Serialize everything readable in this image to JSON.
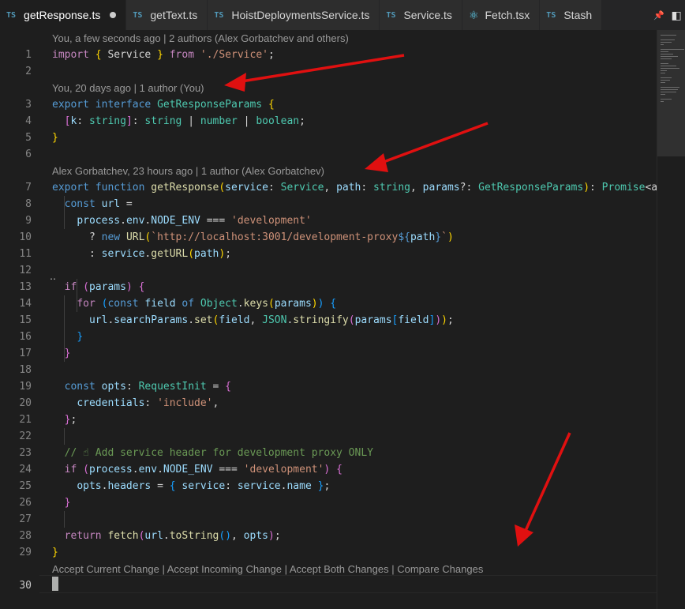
{
  "tabs": [
    {
      "badge": "TS",
      "label": "getResponse.ts",
      "active": true,
      "modified": true
    },
    {
      "badge": "TS",
      "label": "getText.ts"
    },
    {
      "badge": "TS",
      "label": "HoistDeploymentsService.ts"
    },
    {
      "badge": "TS",
      "label": "Service.ts"
    },
    {
      "badge": "⚛",
      "label": "Fetch.tsx"
    },
    {
      "badge": "TS",
      "label": "Stash"
    }
  ],
  "tab_actions": {
    "pin": "📌",
    "split": "◧"
  },
  "lenses": {
    "l1": "You, a few seconds ago | 2 authors (Alex Gorbatchev and others)",
    "l3": "You, 20 days ago | 1 author (You)",
    "l7": "Alex Gorbatchev, 23 hours ago | 1 author (Alex Gorbatchev)",
    "merge": "Accept Current Change | Accept Incoming Change | Accept Both Changes | Compare Changes"
  },
  "line_numbers": [
    "1",
    "2",
    "3",
    "4",
    "5",
    "6",
    "7",
    "8",
    "9",
    "10",
    "11",
    "12",
    "13",
    "14",
    "15",
    "16",
    "17",
    "18",
    "19",
    "20",
    "21",
    "22",
    "23",
    "24",
    "25",
    "26",
    "27",
    "28",
    "29",
    "30"
  ],
  "code": {
    "l1": [
      [
        "k",
        "import"
      ],
      [
        "p",
        " "
      ],
      [
        "br1",
        "{"
      ],
      [
        "p",
        " Service "
      ],
      [
        "br1",
        "}"
      ],
      [
        "p",
        " "
      ],
      [
        "k",
        "from"
      ],
      [
        "p",
        " "
      ],
      [
        "s",
        "'./Service'"
      ],
      [
        "p",
        ";"
      ]
    ],
    "l3": [
      [
        "b",
        "export"
      ],
      [
        "p",
        " "
      ],
      [
        "b",
        "interface"
      ],
      [
        "p",
        " "
      ],
      [
        "t",
        "GetResponseParams"
      ],
      [
        "p",
        " "
      ],
      [
        "br1",
        "{"
      ]
    ],
    "l4": [
      [
        "p",
        "  "
      ],
      [
        "br2",
        "["
      ],
      [
        "v",
        "k"
      ],
      [
        "p",
        ": "
      ],
      [
        "t",
        "string"
      ],
      [
        "br2",
        "]"
      ],
      [
        "p",
        ": "
      ],
      [
        "t",
        "string"
      ],
      [
        "p",
        " | "
      ],
      [
        "t",
        "number"
      ],
      [
        "p",
        " | "
      ],
      [
        "t",
        "boolean"
      ],
      [
        "p",
        ";"
      ]
    ],
    "l5": [
      [
        "br1",
        "}"
      ]
    ],
    "l7": [
      [
        "b",
        "export"
      ],
      [
        "p",
        " "
      ],
      [
        "b",
        "function"
      ],
      [
        "p",
        " "
      ],
      [
        "f",
        "getResponse"
      ],
      [
        "br1",
        "("
      ],
      [
        "v",
        "service"
      ],
      [
        "p",
        ": "
      ],
      [
        "t",
        "Service"
      ],
      [
        "p",
        ", "
      ],
      [
        "v",
        "path"
      ],
      [
        "p",
        ": "
      ],
      [
        "t",
        "string"
      ],
      [
        "p",
        ", "
      ],
      [
        "v",
        "params"
      ],
      [
        "p",
        "?: "
      ],
      [
        "t",
        "GetResponseParams"
      ],
      [
        "br1",
        ")"
      ],
      [
        "p",
        ": "
      ],
      [
        "t",
        "Promise"
      ],
      [
        "p",
        "<any"
      ]
    ],
    "l8": [
      [
        "p",
        "  "
      ],
      [
        "b",
        "const"
      ],
      [
        "p",
        " "
      ],
      [
        "v",
        "url"
      ],
      [
        "p",
        " ="
      ]
    ],
    "l9": [
      [
        "p",
        "    "
      ],
      [
        "v",
        "process"
      ],
      [
        "p",
        "."
      ],
      [
        "v",
        "env"
      ],
      [
        "p",
        "."
      ],
      [
        "v",
        "NODE_ENV"
      ],
      [
        "p",
        " === "
      ],
      [
        "s",
        "'development'"
      ]
    ],
    "l10": [
      [
        "p",
        "      ? "
      ],
      [
        "b",
        "new"
      ],
      [
        "p",
        " "
      ],
      [
        "f",
        "URL"
      ],
      [
        "br1",
        "("
      ],
      [
        "s",
        "`http://localhost:3001/development-proxy"
      ],
      [
        "b",
        "${"
      ],
      [
        "v",
        "path"
      ],
      [
        "b",
        "}"
      ],
      [
        "s",
        "`"
      ],
      [
        "br1",
        ")"
      ]
    ],
    "l11": [
      [
        "p",
        "      : "
      ],
      [
        "v",
        "service"
      ],
      [
        "p",
        "."
      ],
      [
        "f",
        "getURL"
      ],
      [
        "br1",
        "("
      ],
      [
        "v",
        "path"
      ],
      [
        "br1",
        ")"
      ],
      [
        "p",
        ";"
      ]
    ],
    "l13": [
      [
        "p",
        "  "
      ],
      [
        "k",
        "if"
      ],
      [
        "p",
        " "
      ],
      [
        "br2",
        "("
      ],
      [
        "v",
        "params"
      ],
      [
        "br2",
        ")"
      ],
      [
        "p",
        " "
      ],
      [
        "br2",
        "{"
      ]
    ],
    "l14": [
      [
        "p",
        "    "
      ],
      [
        "k",
        "for"
      ],
      [
        "p",
        " "
      ],
      [
        "br3",
        "("
      ],
      [
        "b",
        "const"
      ],
      [
        "p",
        " "
      ],
      [
        "v",
        "field"
      ],
      [
        "p",
        " "
      ],
      [
        "b",
        "of"
      ],
      [
        "p",
        " "
      ],
      [
        "t",
        "Object"
      ],
      [
        "p",
        "."
      ],
      [
        "f",
        "keys"
      ],
      [
        "br1",
        "("
      ],
      [
        "v",
        "params"
      ],
      [
        "br1",
        ")"
      ],
      [
        "br3",
        ")"
      ],
      [
        "p",
        " "
      ],
      [
        "br3",
        "{"
      ]
    ],
    "l15": [
      [
        "p",
        "      "
      ],
      [
        "v",
        "url"
      ],
      [
        "p",
        "."
      ],
      [
        "v",
        "searchParams"
      ],
      [
        "p",
        "."
      ],
      [
        "f",
        "set"
      ],
      [
        "br1",
        "("
      ],
      [
        "v",
        "field"
      ],
      [
        "p",
        ", "
      ],
      [
        "t",
        "JSON"
      ],
      [
        "p",
        "."
      ],
      [
        "f",
        "stringify"
      ],
      [
        "br2",
        "("
      ],
      [
        "v",
        "params"
      ],
      [
        "br3",
        "["
      ],
      [
        "v",
        "field"
      ],
      [
        "br3",
        "]"
      ],
      [
        "br2",
        ")"
      ],
      [
        "br1",
        ")"
      ],
      [
        "p",
        ";"
      ]
    ],
    "l16": [
      [
        "p",
        "    "
      ],
      [
        "br3",
        "}"
      ]
    ],
    "l17": [
      [
        "p",
        "  "
      ],
      [
        "br2",
        "}"
      ]
    ],
    "l19": [
      [
        "p",
        "  "
      ],
      [
        "b",
        "const"
      ],
      [
        "p",
        " "
      ],
      [
        "v",
        "opts"
      ],
      [
        "p",
        ": "
      ],
      [
        "t",
        "RequestInit"
      ],
      [
        "p",
        " = "
      ],
      [
        "br2",
        "{"
      ]
    ],
    "l20": [
      [
        "p",
        "    "
      ],
      [
        "v",
        "credentials"
      ],
      [
        "p",
        ": "
      ],
      [
        "s",
        "'include'"
      ],
      [
        "p",
        ","
      ]
    ],
    "l21": [
      [
        "p",
        "  "
      ],
      [
        "br2",
        "}"
      ],
      [
        "p",
        ";"
      ]
    ],
    "l23": [
      [
        "p",
        "  "
      ],
      [
        "c",
        "// ☝ Add service header for development proxy ONLY"
      ]
    ],
    "l24": [
      [
        "p",
        "  "
      ],
      [
        "k",
        "if"
      ],
      [
        "p",
        " "
      ],
      [
        "br2",
        "("
      ],
      [
        "v",
        "process"
      ],
      [
        "p",
        "."
      ],
      [
        "v",
        "env"
      ],
      [
        "p",
        "."
      ],
      [
        "v",
        "NODE_ENV"
      ],
      [
        "p",
        " === "
      ],
      [
        "s",
        "'development'"
      ],
      [
        "br2",
        ")"
      ],
      [
        "p",
        " "
      ],
      [
        "br2",
        "{"
      ]
    ],
    "l25": [
      [
        "p",
        "    "
      ],
      [
        "v",
        "opts"
      ],
      [
        "p",
        "."
      ],
      [
        "v",
        "headers"
      ],
      [
        "p",
        " = "
      ],
      [
        "br3",
        "{"
      ],
      [
        "p",
        " "
      ],
      [
        "v",
        "service"
      ],
      [
        "p",
        ": "
      ],
      [
        "v",
        "service"
      ],
      [
        "p",
        "."
      ],
      [
        "v",
        "name"
      ],
      [
        "p",
        " "
      ],
      [
        "br3",
        "}"
      ],
      [
        "p",
        ";"
      ]
    ],
    "l26": [
      [
        "p",
        "  "
      ],
      [
        "br2",
        "}"
      ]
    ],
    "l28": [
      [
        "p",
        "  "
      ],
      [
        "k",
        "return"
      ],
      [
        "p",
        " "
      ],
      [
        "f",
        "fetch"
      ],
      [
        "br2",
        "("
      ],
      [
        "v",
        "url"
      ],
      [
        "p",
        "."
      ],
      [
        "f",
        "toString"
      ],
      [
        "br3",
        "("
      ],
      [
        "br3",
        ")"
      ],
      [
        "p",
        ", "
      ],
      [
        "v",
        "opts"
      ],
      [
        "br2",
        ")"
      ],
      [
        "p",
        ";"
      ]
    ],
    "l29": [
      [
        "br1",
        "}"
      ]
    ]
  },
  "fold_marker": "‥"
}
